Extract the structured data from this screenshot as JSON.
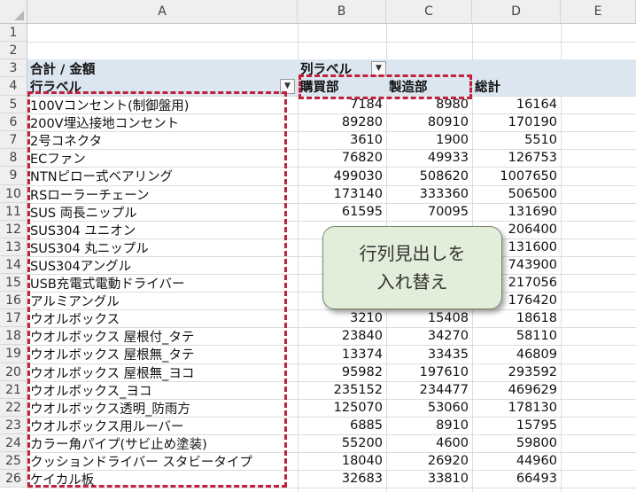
{
  "columns": [
    "A",
    "B",
    "C",
    "D",
    "E"
  ],
  "header": {
    "sum_label": "合計 / 金額",
    "col_label": "列ラベル",
    "row_label": "行ラベル",
    "col1": "購買部",
    "col2": "製造部",
    "total": "総計"
  },
  "rows": [
    {
      "n": "5",
      "label": "100Vコンセント(制御盤用)",
      "b": "7184",
      "c": "8980",
      "d": "16164"
    },
    {
      "n": "6",
      "label": "200V埋込接地コンセント",
      "b": "89280",
      "c": "80910",
      "d": "170190"
    },
    {
      "n": "7",
      "label": "2号コネクタ",
      "b": "3610",
      "c": "1900",
      "d": "5510"
    },
    {
      "n": "8",
      "label": "ECファン",
      "b": "76820",
      "c": "49933",
      "d": "126753"
    },
    {
      "n": "9",
      "label": "NTNピロー式ベアリング",
      "b": "499030",
      "c": "508620",
      "d": "1007650"
    },
    {
      "n": "10",
      "label": "RSローラーチェーン",
      "b": "173140",
      "c": "333360",
      "d": "506500"
    },
    {
      "n": "11",
      "label": "SUS 両長ニップル",
      "b": "61595",
      "c": "70095",
      "d": "131690"
    },
    {
      "n": "12",
      "label": "SUS304 ユニオン",
      "b": "",
      "c": "",
      "d": "206400"
    },
    {
      "n": "13",
      "label": "SUS304 丸ニップル",
      "b": "",
      "c": "",
      "d": "131600"
    },
    {
      "n": "14",
      "label": "SUS304アングル",
      "b": "",
      "c": "",
      "d": "743900"
    },
    {
      "n": "15",
      "label": "USB充電式電動ドライバー",
      "b": "",
      "c": "",
      "d": "217056"
    },
    {
      "n": "16",
      "label": "アルミアングル",
      "b": "",
      "c": "",
      "d": "176420"
    },
    {
      "n": "17",
      "label": "ウオルボックス",
      "b": "3210",
      "c": "15408",
      "d": "18618"
    },
    {
      "n": "18",
      "label": "ウオルボックス 屋根付_タテ",
      "b": "23840",
      "c": "34270",
      "d": "58110"
    },
    {
      "n": "19",
      "label": "ウオルボックス 屋根無_タテ",
      "b": "13374",
      "c": "33435",
      "d": "46809"
    },
    {
      "n": "20",
      "label": "ウオルボックス 屋根無_ヨコ",
      "b": "95982",
      "c": "197610",
      "d": "293592"
    },
    {
      "n": "21",
      "label": "ウオルボックス_ヨコ",
      "b": "235152",
      "c": "234477",
      "d": "469629"
    },
    {
      "n": "22",
      "label": "ウオルボックス透明_防雨方",
      "b": "125070",
      "c": "53060",
      "d": "178130"
    },
    {
      "n": "23",
      "label": "ウオルボックス用ルーバー",
      "b": "6885",
      "c": "8910",
      "d": "15795"
    },
    {
      "n": "24",
      "label": "カラー角パイプ(サビ止め塗装)",
      "b": "55200",
      "c": "4600",
      "d": "59800"
    },
    {
      "n": "25",
      "label": "クッションドライバー スタビータイプ",
      "b": "18040",
      "c": "26920",
      "d": "44960"
    },
    {
      "n": "26",
      "label": "ケイカル板",
      "b": "32683",
      "c": "33810",
      "d": "66493"
    }
  ],
  "callout": {
    "line1": "行列見出しを",
    "line2": "入れ替え"
  },
  "colors": {
    "header_band": "#dce6f1",
    "dash": "#c0223b",
    "callout_bg": "#e2eed9"
  }
}
